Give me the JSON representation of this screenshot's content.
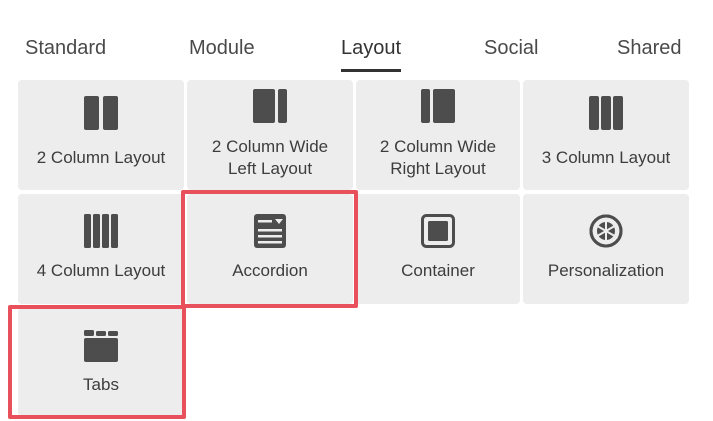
{
  "tabs": [
    {
      "label": "Standard"
    },
    {
      "label": "Module"
    },
    {
      "label": "Layout"
    },
    {
      "label": "Social"
    },
    {
      "label": "Shared"
    }
  ],
  "active_tab": "Layout",
  "tiles": [
    {
      "label_line1": "2 Column Layout",
      "label_line2": "",
      "icon": "two-column-icon"
    },
    {
      "label_line1": "2 Column Wide",
      "label_line2": "Left Layout",
      "icon": "two-column-wide-left-icon"
    },
    {
      "label_line1": "2 Column Wide",
      "label_line2": "Right Layout",
      "icon": "two-column-wide-right-icon"
    },
    {
      "label_line1": "3 Column Layout",
      "label_line2": "",
      "icon": "three-column-icon"
    },
    {
      "label_line1": "4 Column Layout",
      "label_line2": "",
      "icon": "four-column-icon"
    },
    {
      "label_line1": "Accordion",
      "label_line2": "",
      "icon": "accordion-icon"
    },
    {
      "label_line1": "Container",
      "label_line2": "",
      "icon": "container-icon"
    },
    {
      "label_line1": "Personalization",
      "label_line2": "",
      "icon": "personalization-icon"
    },
    {
      "label_line1": "Tabs",
      "label_line2": "",
      "icon": "tabs-icon"
    }
  ],
  "colors": {
    "tile_bg": "#ededed",
    "icon": "#4d4d4d",
    "highlight": "#e8505b"
  }
}
